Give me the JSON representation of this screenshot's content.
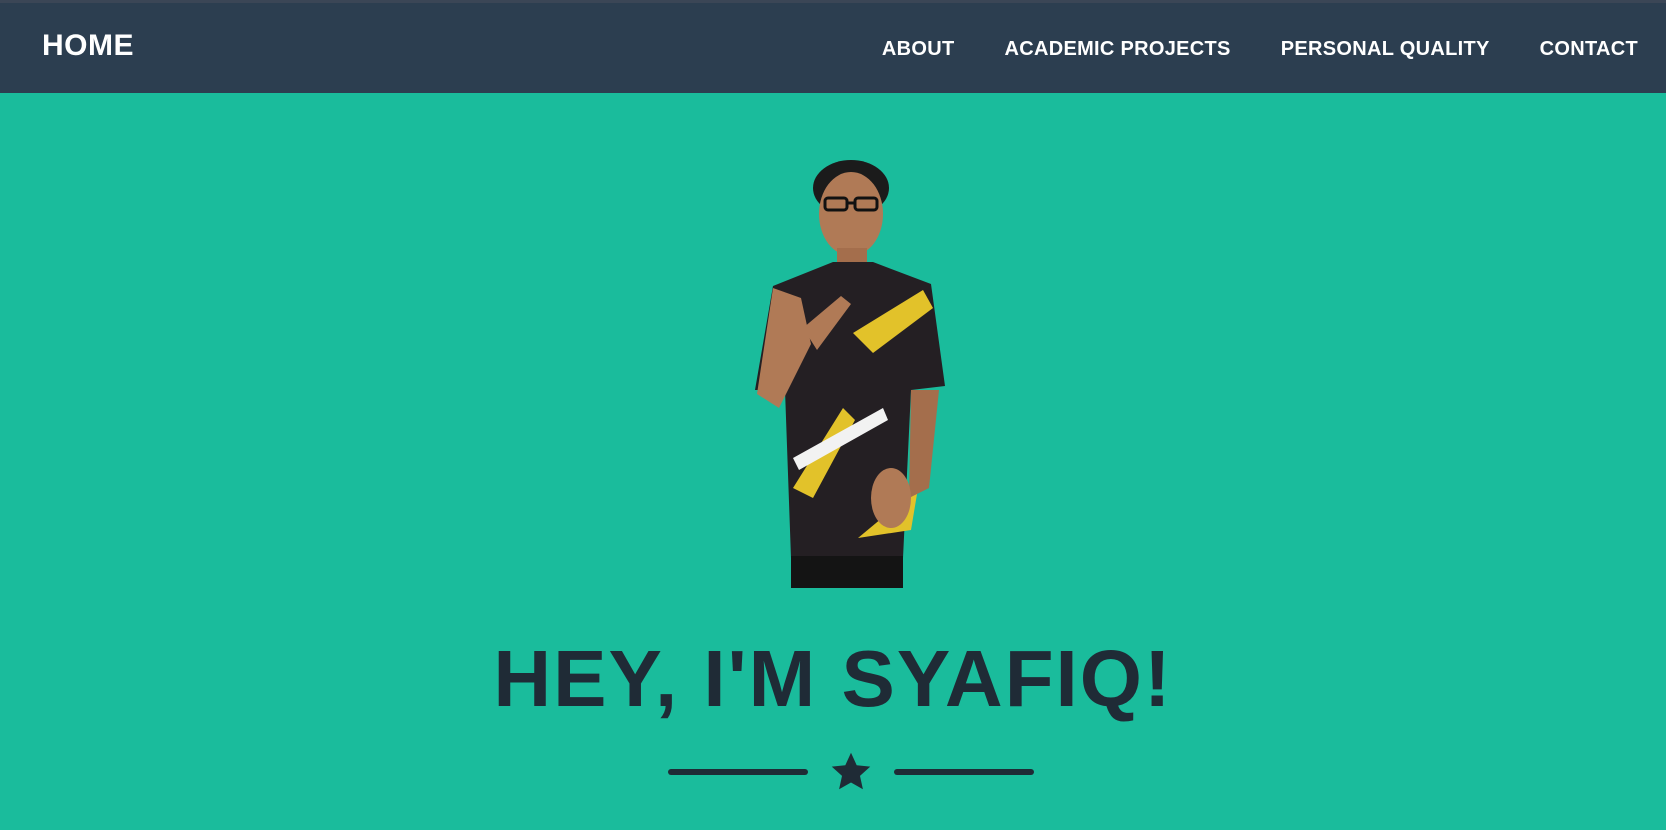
{
  "nav": {
    "brand": "HOME",
    "links": [
      {
        "label": "ABOUT"
      },
      {
        "label": "ACADEMIC PROJECTS"
      },
      {
        "label": "PERSONAL QUALITY"
      },
      {
        "label": "CONTACT"
      }
    ]
  },
  "hero": {
    "heading": "HEY, I'M SYAFIQ!",
    "divider_icon": "star-icon"
  },
  "colors": {
    "navbar": "#2c3e50",
    "background": "#1abc9c",
    "heading": "#1f2b36",
    "nav_text": "#ffffff"
  }
}
